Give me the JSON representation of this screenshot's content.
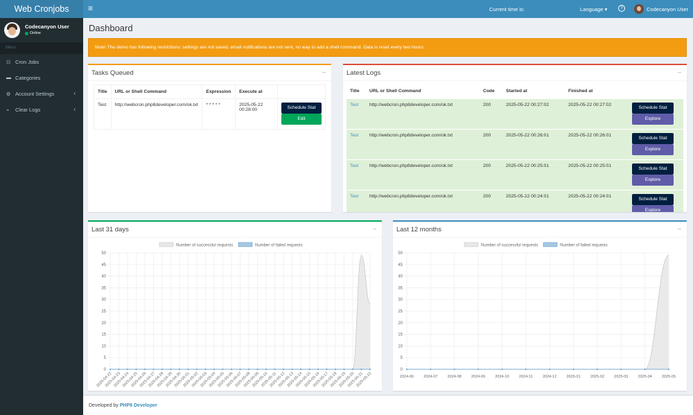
{
  "app": {
    "logo": "Web Cronjobs"
  },
  "topbar": {
    "menu_icon": "≡",
    "current_time_label": "Current time is:",
    "language": "Language ▾",
    "help_icon": "?",
    "user_name": "Codecanyon User"
  },
  "sidebar": {
    "user_name": "Codecanyon User",
    "status": "Online",
    "header": "Menu",
    "items": [
      {
        "label": "Cron Jobs",
        "icon": "☷"
      },
      {
        "label": "Categories",
        "icon": "▬"
      },
      {
        "label": "Account Settings",
        "icon": "⚙",
        "arrow": "‹"
      },
      {
        "label": "Clear Logs",
        "icon": "⌁",
        "arrow": "‹"
      }
    ]
  },
  "page": {
    "title": "Dashboard",
    "alert": "Note! The demo has following restrictions: settings are not saved, email notifications are not sent, no way to add a shell command. Data is reset every two hours."
  },
  "tasks_queued": {
    "title": "Tasks Queued",
    "collapse": "–",
    "headers": [
      "Title",
      "URL or Shell Command",
      "Expression",
      "Execute at",
      ""
    ],
    "rows": [
      {
        "title": "Test",
        "url": "http://webcron.php8developer.com/ok.txt",
        "expression": "* * * * *",
        "execute_at": "2025-05-22 00:28:00",
        "btn_schedule": "Schedule Stat",
        "btn_edit": "Edit"
      }
    ]
  },
  "latest_logs": {
    "title": "Latest Logs",
    "collapse": "–",
    "headers": [
      "Title",
      "URL or Shell Command",
      "Code",
      "Started at",
      "Finished at",
      ""
    ],
    "rows": [
      {
        "title": "Test",
        "url": "http://webcron.php8developer.com/ok.txt",
        "code": "200",
        "started": "2025-05-22 00:27:02",
        "finished": "2025-05-22 00:27:02",
        "btn_schedule": "Schedule Stat",
        "btn_explore": "Explore"
      },
      {
        "title": "Test",
        "url": "http://webcron.php8developer.com/ok.txt",
        "code": "200",
        "started": "2025-05-22 00:26:01",
        "finished": "2025-05-22 00:26:01",
        "btn_schedule": "Schedule Stat",
        "btn_explore": "Explore"
      },
      {
        "title": "Test",
        "url": "http://webcron.php8developer.com/ok.txt",
        "code": "200",
        "started": "2025-05-22 00:25:01",
        "finished": "2025-05-22 00:25:01",
        "btn_schedule": "Schedule Stat",
        "btn_explore": "Explore"
      },
      {
        "title": "Test",
        "url": "http://webcron.php8developer.com/ok.txt",
        "code": "200",
        "started": "2025-05-22 00:24:01",
        "finished": "2025-05-22 00:24:01",
        "btn_schedule": "Schedule Stat",
        "btn_explore": "Explore"
      }
    ]
  },
  "last31": {
    "title": "Last 31 days",
    "collapse": "–"
  },
  "last12": {
    "title": "Last 12 months",
    "collapse": "–"
  },
  "footer": {
    "prefix": "Developed by ",
    "brand": "PHP8 Developer"
  },
  "colors": {
    "success_fill": "#e8e8e8",
    "success_line": "#c8c8c8",
    "failed_fill": "#a8c8e0",
    "failed_line": "#5a9bd0",
    "grid": "#ececec"
  },
  "chart_data": [
    {
      "type": "area",
      "legend": [
        "Number of successful requests",
        "Number of failed requests"
      ],
      "ylim": [
        0,
        50
      ],
      "yticks": [
        0,
        5,
        10,
        15,
        20,
        25,
        30,
        35,
        40,
        45,
        50
      ],
      "categories": [
        "2025-04-22",
        "2025-04-23",
        "2025-04-24",
        "2025-04-25",
        "2025-04-26",
        "2025-04-27",
        "2025-04-28",
        "2025-04-29",
        "2025-04-30",
        "2025-05-01",
        "2025-05-02",
        "2025-05-03",
        "2025-05-04",
        "2025-05-05",
        "2025-05-06",
        "2025-05-07",
        "2025-05-08",
        "2025-05-09",
        "2025-05-10",
        "2025-05-11",
        "2025-05-12",
        "2025-05-13",
        "2025-05-14",
        "2025-05-15",
        "2025-05-16",
        "2025-05-17",
        "2025-05-18",
        "2025-05-19",
        "2025-05-20",
        "2025-05-21",
        "2025-05-22"
      ],
      "series": [
        {
          "name": "Number of successful requests",
          "values": [
            0,
            0,
            0,
            0,
            0,
            0,
            0,
            0,
            0,
            0,
            0,
            0,
            0,
            0,
            0,
            0,
            0,
            0,
            0,
            0,
            0,
            0,
            0,
            0,
            0,
            0,
            0,
            0,
            0,
            49,
            28
          ]
        },
        {
          "name": "Number of failed requests",
          "values": [
            0,
            0,
            0,
            0,
            0,
            0,
            0,
            0,
            0,
            0,
            0,
            0,
            0,
            0,
            0,
            0,
            0,
            0,
            0,
            0,
            0,
            0,
            0,
            0,
            0,
            0,
            0,
            0,
            0,
            0,
            0
          ]
        }
      ]
    },
    {
      "type": "area",
      "legend": [
        "Number of successful requests",
        "Number of failed requests"
      ],
      "ylim": [
        0,
        50
      ],
      "yticks": [
        0,
        5,
        10,
        15,
        20,
        25,
        30,
        35,
        40,
        45,
        50
      ],
      "categories": [
        "2024-06",
        "2024-07",
        "2024-08",
        "2024-09",
        "2024-10",
        "2024-11",
        "2024-12",
        "2025-01",
        "2025-02",
        "2025-03",
        "2025-04",
        "2025-05"
      ],
      "series": [
        {
          "name": "Number of successful requests",
          "values": [
            0,
            0,
            0,
            0,
            0,
            0,
            0,
            0,
            0,
            0,
            0,
            49
          ]
        },
        {
          "name": "Number of failed requests",
          "values": [
            0,
            0,
            0,
            0,
            0,
            0,
            0,
            0,
            0,
            0,
            0,
            0
          ]
        }
      ]
    }
  ]
}
